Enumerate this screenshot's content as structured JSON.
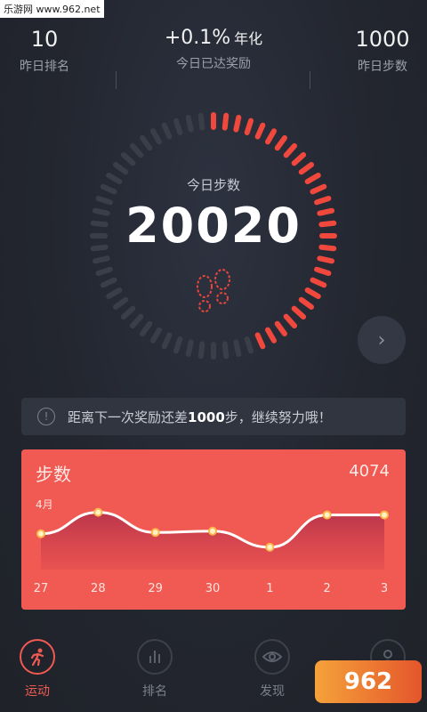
{
  "watermark": "乐游网 www.962.net",
  "stats": {
    "rank": {
      "value": "10",
      "label": "昨日排名"
    },
    "reward": {
      "value": "+0.1%",
      "unit": "年化",
      "label": "今日已达奖励"
    },
    "steps_yesterday": {
      "value": "1000",
      "label": "昨日步数"
    }
  },
  "today": {
    "label": "今日步数",
    "steps": "20020",
    "progress": 0.45
  },
  "notice": {
    "prefix": "距离下一次奖励还差",
    "highlight": "1000",
    "suffix": "步，继续努力哦！"
  },
  "card": {
    "title": "步数",
    "value": "4074",
    "month": "4月",
    "chart_data": {
      "type": "area",
      "categories": [
        "27",
        "28",
        "29",
        "30",
        "1",
        "2",
        "3"
      ],
      "values": [
        6200,
        7800,
        6300,
        6400,
        5200,
        7600,
        7600
      ]
    }
  },
  "tabs": [
    {
      "label": "运动",
      "icon": "run-icon",
      "active": true
    },
    {
      "label": "排名",
      "icon": "bar-chart-icon",
      "active": false
    },
    {
      "label": "发现",
      "icon": "eye-icon",
      "active": false
    },
    {
      "label": "",
      "icon": "user-icon",
      "active": false
    }
  ],
  "badge": "962"
}
